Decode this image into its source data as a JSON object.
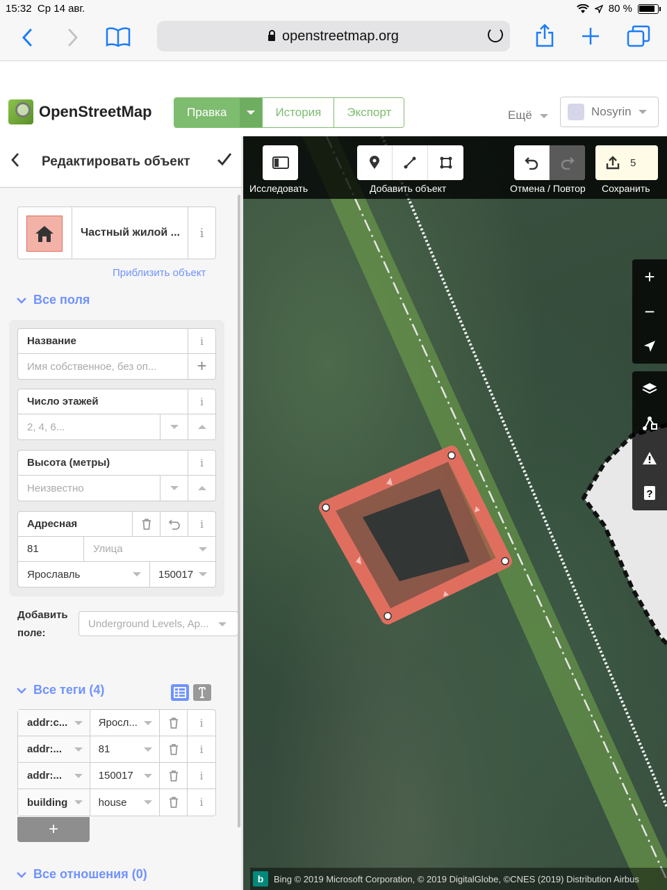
{
  "status": {
    "time": "15:32",
    "date": "Ср 14 авг.",
    "battery": "80 %"
  },
  "browser": {
    "url": "openstreetmap.org"
  },
  "header": {
    "site_name": "OpenStreetMap",
    "tabs": {
      "edit": "Правка",
      "history": "История",
      "export": "Экспорт"
    },
    "more": "Ещё",
    "user": "Nosyrin"
  },
  "sidebar": {
    "title": "Редактировать объект",
    "preset_name": "Частный жилой ...",
    "zoom_to": "Приблизить объект",
    "all_fields": "Все поля",
    "fields": {
      "name": {
        "label": "Название",
        "placeholder": "Имя собственное, без оп..."
      },
      "levels": {
        "label": "Число этажей",
        "placeholder": "2, 4, 6..."
      },
      "height": {
        "label": "Высота (метры)",
        "placeholder": "Неизвестно"
      },
      "address": {
        "label": "Адресная",
        "housenumber": "81",
        "street_placeholder": "Улица",
        "city": "Ярославль",
        "postcode": "150017"
      }
    },
    "add_field_label_1": "Добавить",
    "add_field_label_2": "поле:",
    "add_field_placeholder": "Underground Levels, Ap...",
    "all_tags": "Все теги (4)",
    "tags": [
      {
        "key": "addr:c...",
        "value": "Яросл..."
      },
      {
        "key": "addr:...",
        "value": "81"
      },
      {
        "key": "addr:...",
        "value": "150017"
      },
      {
        "key": "building",
        "value": "house"
      }
    ],
    "add_tag": "+",
    "all_relations": "Все отношения (0)"
  },
  "map": {
    "toolbar": {
      "browse_label": "Исследовать",
      "add_label": "Добавить объект",
      "undo_redo_label": "Отмена / Повтор",
      "save_label": "Сохранить",
      "save_count": "5"
    },
    "attribution": "Bing  © 2019 Microsoft Corporation, © 2019 DigitalGlobe, ©CNES (2019) Distribution Airbus",
    "colors": {
      "selection": "#e06e5f",
      "accent": "#7ebc6f",
      "link": "#7092ff"
    }
  }
}
